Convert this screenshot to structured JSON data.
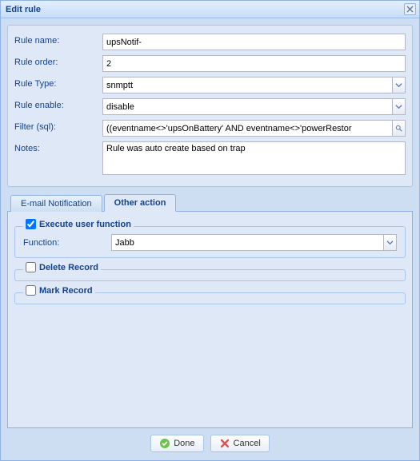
{
  "window": {
    "title": "Edit rule"
  },
  "form": {
    "rule_name": {
      "label": "Rule name:",
      "value": "upsNotif-"
    },
    "rule_order": {
      "label": "Rule order:",
      "value": "2"
    },
    "rule_type": {
      "label": "Rule Type:",
      "value": "snmptt"
    },
    "rule_enable": {
      "label": "Rule enable:",
      "value": "disable"
    },
    "filter_sql": {
      "label": "Filter (sql):",
      "value": "((eventname<>'upsOnBattery' AND eventname<>'powerRestor"
    },
    "notes": {
      "label": "Notes:",
      "value": "Rule was auto create based on trap"
    }
  },
  "tabs": {
    "email": {
      "label": "E-mail Notification"
    },
    "other": {
      "label": "Other action"
    }
  },
  "other_action": {
    "execute_user_function": {
      "legend": "Execute user function",
      "checked": true
    },
    "function": {
      "label": "Function:",
      "value": "Jabb"
    },
    "delete_record": {
      "legend": "Delete Record",
      "checked": false
    },
    "mark_record": {
      "legend": "Mark Record",
      "checked": false
    }
  },
  "buttons": {
    "done": "Done",
    "cancel": "Cancel"
  }
}
